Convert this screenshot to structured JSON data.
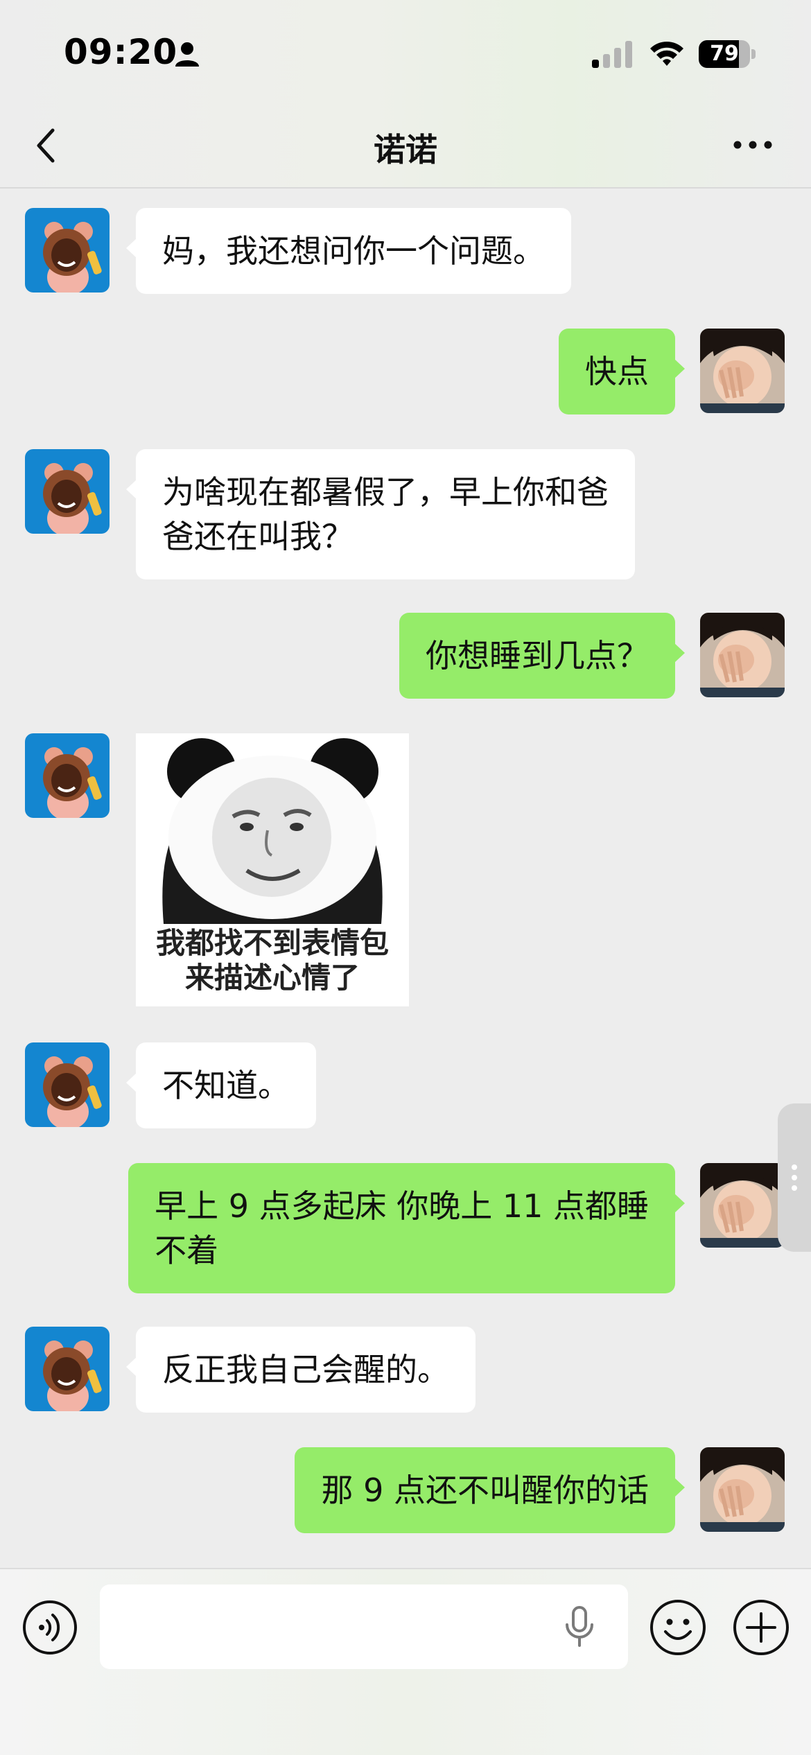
{
  "status_bar": {
    "time": "09:20",
    "battery": "79",
    "battery_level": 0.79
  },
  "header": {
    "title": "诺诺"
  },
  "messages": [
    {
      "from": "them",
      "type": "text",
      "text": "妈，我还想问你一个问题。"
    },
    {
      "from": "me",
      "type": "text",
      "text": "快点"
    },
    {
      "from": "them",
      "type": "text",
      "text": "为啥现在都暑假了，早上你和爸\n爸还在叫我？"
    },
    {
      "from": "me",
      "type": "text",
      "text": "你想睡到几点？"
    },
    {
      "from": "them",
      "type": "sticker",
      "caption": "我都找不到表情包\n来描述心情了"
    },
    {
      "from": "them",
      "type": "text",
      "text": "不知道。"
    },
    {
      "from": "me",
      "type": "text",
      "text": "早上 9 点多起床 你晚上 11 点都睡\n不着"
    },
    {
      "from": "them",
      "type": "text",
      "text": "反正我自己会醒的。"
    },
    {
      "from": "me",
      "type": "text",
      "text": "那 9 点还不叫醒你的话"
    }
  ],
  "colors": {
    "incoming_bubble": "#ffffff",
    "outgoing_bubble": "#95ec69",
    "background": "#ededed"
  },
  "icons": {
    "voice": "voice-input-icon",
    "mic": "microphone-icon",
    "emoji": "emoji-icon",
    "plus": "plus-icon",
    "back": "back-chevron-icon",
    "more": "more-dots-icon"
  }
}
